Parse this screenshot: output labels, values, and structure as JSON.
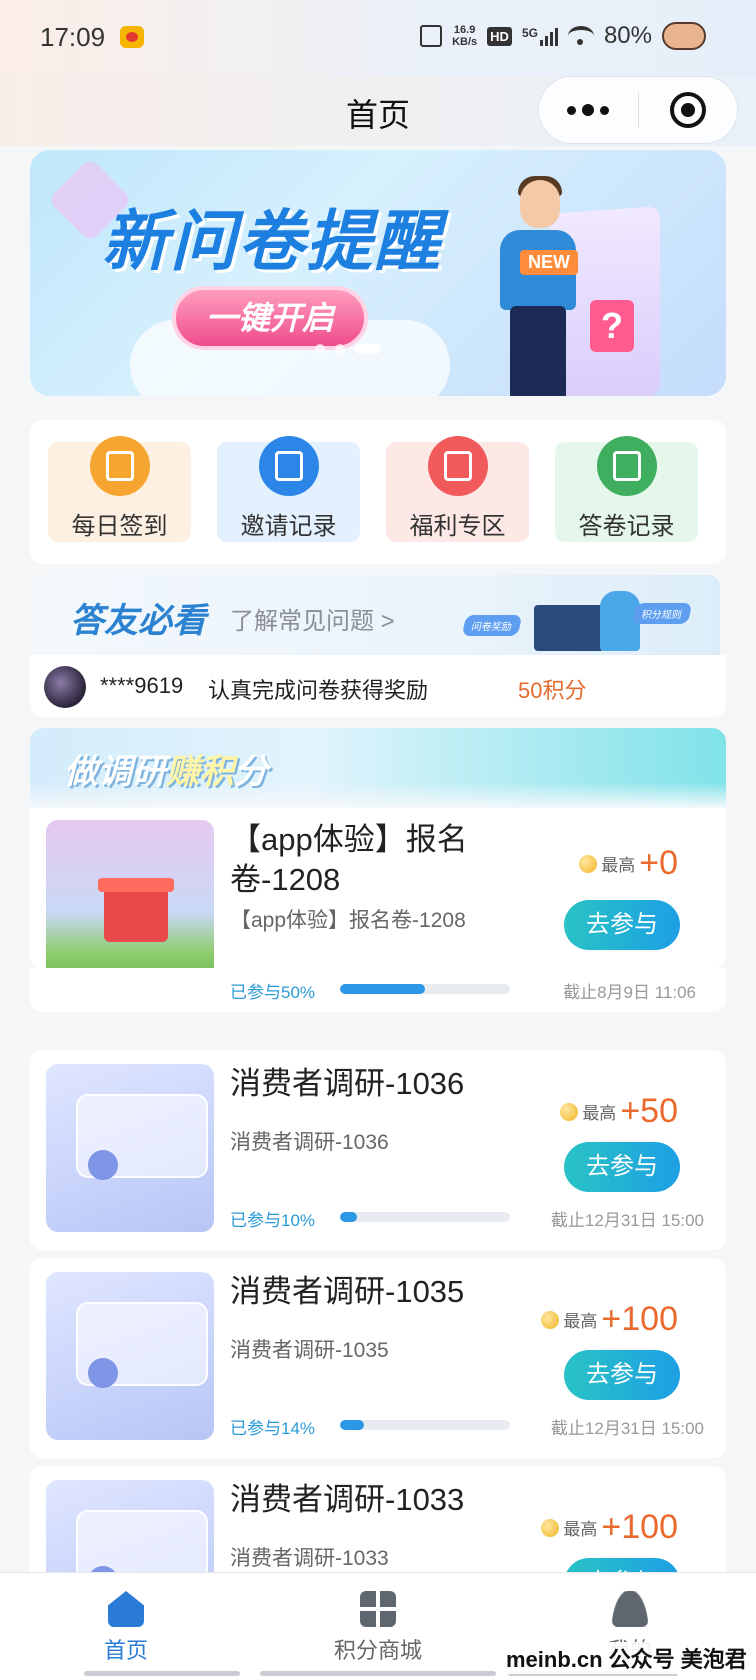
{
  "status_bar": {
    "time": "17:09",
    "network_speed": "16.9\nKB/s",
    "hd": "HD",
    "signal": "5G",
    "battery": "80%"
  },
  "header": {
    "title": "首页",
    "more_icon": "more-dots-icon",
    "close_icon": "target-circle-icon"
  },
  "banner": {
    "title": "新问卷提醒",
    "button": "一键开启",
    "new_tag": "NEW",
    "question_mark": "?",
    "slides": 3,
    "active_slide": 3
  },
  "quick_menu": [
    {
      "label": "每日签到",
      "icon": "checkin-icon",
      "color": "#f7a531",
      "bg": "#fdf0e2"
    },
    {
      "label": "邀请记录",
      "icon": "invite-icon",
      "color": "#2c86e8",
      "bg": "#e3f0fd"
    },
    {
      "label": "福利专区",
      "icon": "gift-icon",
      "color": "#f05a5a",
      "bg": "#fde8e6"
    },
    {
      "label": "答卷记录",
      "icon": "record-icon",
      "color": "#3fae5f",
      "bg": "#e5f6ea"
    }
  ],
  "faq": {
    "title": "答友必看",
    "link": "了解常见问题 >",
    "tag1": "问卷奖励",
    "tag2": "积分规则"
  },
  "ticker": {
    "user": "****9619",
    "message": "认真完成问卷获得奖励",
    "points": "50积分"
  },
  "section": {
    "title_a": "做调研",
    "title_b": "赚积",
    "title_c": "分"
  },
  "surveys": [
    {
      "title": "【app体验】报名卷-1208",
      "subtitle": "【app体验】报名卷-1208",
      "max_label": "最高",
      "points": "+0",
      "button": "去参与",
      "progress_label": "已参与50%",
      "progress": 0.5,
      "deadline": "截止8月9日 11:06",
      "thumb": "gift"
    },
    {
      "title": "消费者调研-1036",
      "subtitle": "消费者调研-1036",
      "max_label": "最高",
      "points": "+50",
      "button": "去参与",
      "progress_label": "已参与10%",
      "progress": 0.1,
      "deadline": "截止12月31日 15:00",
      "thumb": "ui"
    },
    {
      "title": "消费者调研-1035",
      "subtitle": "消费者调研-1035",
      "max_label": "最高",
      "points": "+100",
      "button": "去参与",
      "progress_label": "已参与14%",
      "progress": 0.14,
      "deadline": "截止12月31日 15:00",
      "thumb": "ui"
    },
    {
      "title": "消费者调研-1033",
      "subtitle": "消费者调研-1033",
      "max_label": "最高",
      "points": "+100",
      "button": "去参与",
      "thumb": "ui"
    }
  ],
  "tabbar": {
    "tabs": [
      {
        "label": "首页",
        "icon": "home-icon",
        "active": true
      },
      {
        "label": "积分商城",
        "icon": "grid-icon",
        "active": false
      },
      {
        "label": "我的",
        "icon": "user-icon",
        "active": false
      }
    ]
  },
  "watermark": "meinb.cn 公众号 美泡君",
  "colors": {
    "accent": "#2a7bd5",
    "points": "#ea6a2e",
    "button_gradient_start": "#29c3c5",
    "button_gradient_end": "#1d9fe4"
  }
}
